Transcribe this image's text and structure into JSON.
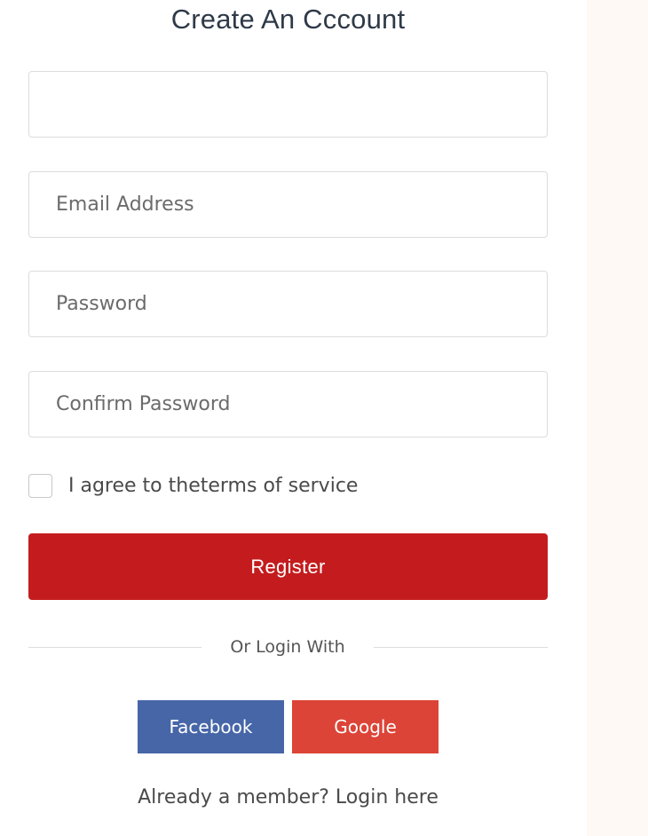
{
  "form": {
    "title": "Create An Cccount",
    "name_field": {
      "value": "",
      "placeholder": ""
    },
    "email_field": {
      "value": "",
      "placeholder": "Email Address"
    },
    "password_field": {
      "value": "",
      "placeholder": "Password"
    },
    "confirm_password_field": {
      "value": "",
      "placeholder": "Confirm Password"
    },
    "terms": {
      "label": "I agree to theterms of service",
      "checked": false
    },
    "register_label": "Register",
    "divider_text": "Or Login With",
    "social": {
      "facebook_label": "Facebook",
      "google_label": "Google"
    },
    "member_text": "Already a member? Login here"
  },
  "colors": {
    "register": "#c41c1e",
    "facebook": "#4766a8",
    "google": "#dc4437",
    "side_panel": "#fff9f6"
  }
}
